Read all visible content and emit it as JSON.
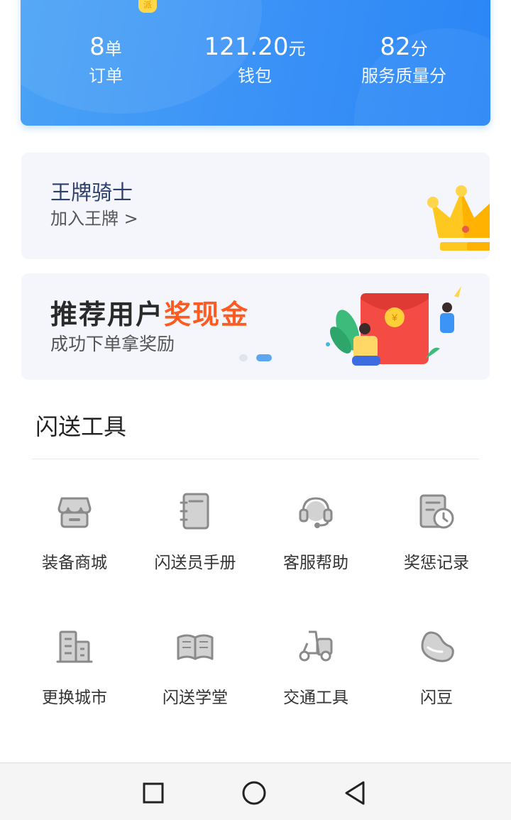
{
  "stats": {
    "orders": {
      "value": "8",
      "unit": "单",
      "label": "订单"
    },
    "wallet": {
      "value": "121.20",
      "unit": "元",
      "label": "钱包"
    },
    "score": {
      "value": "82",
      "unit": "分",
      "label": "服务质量分"
    },
    "avatar_badge": "派"
  },
  "ace_banner": {
    "title": "王牌骑士",
    "subtitle": "加入王牌 >"
  },
  "referral_banner": {
    "title_plain": "推荐用户",
    "title_highlight": "奖现金",
    "subtitle": "成功下单拿奖励",
    "active_page": 2,
    "page_count": 2
  },
  "tools": {
    "title": "闪送工具",
    "items": [
      {
        "label": "装备商城",
        "icon": "store-icon"
      },
      {
        "label": "闪送员手册",
        "icon": "handbook-icon"
      },
      {
        "label": "客服帮助",
        "icon": "headset-icon"
      },
      {
        "label": "奖惩记录",
        "icon": "record-icon"
      },
      {
        "label": "更换城市",
        "icon": "city-icon"
      },
      {
        "label": "闪送学堂",
        "icon": "book-icon"
      },
      {
        "label": "交通工具",
        "icon": "scooter-icon"
      },
      {
        "label": "闪豆",
        "icon": "bean-icon"
      }
    ]
  },
  "colors": {
    "header_blue": "#3d94f7",
    "highlight_orange": "#ff5a1f",
    "crown_gold": "#ffc820"
  }
}
